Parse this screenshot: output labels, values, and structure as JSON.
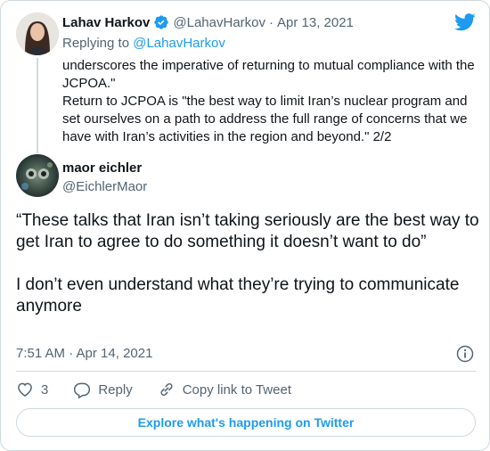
{
  "tweet1": {
    "author_name": "Lahav Harkov",
    "handle": "@LahavHarkov",
    "separator": "·",
    "date": "Apr 13, 2021",
    "replying_prefix": "Replying to ",
    "replying_handle": "@LahavHarkov",
    "paragraph1": "underscores the imperative of returning to mutual compliance with the JCPOA.\"",
    "paragraph2": "Return to JCPOA is \"the best way to limit Iran’s nuclear program and set ourselves on a path to address the full range of concerns that we have with Iran’s activities in the region and beyond.\" 2/2"
  },
  "tweet2": {
    "author_name": "maor eichler",
    "handle": "@EichlerMaor",
    "paragraph1": "“These talks that Iran isn’t taking seriously are the best way to get Iran to agree to do something it doesn’t want to do”",
    "paragraph2": "I don’t even understand what they’re trying to communicate anymore",
    "time": "7:51 AM · Apr 14, 2021"
  },
  "actions": {
    "like_count": "3",
    "reply_label": "Reply",
    "copy_link_label": "Copy link to Tweet"
  },
  "explore_label": "Explore what's happening on Twitter",
  "colors": {
    "accent": "#1d9bf0",
    "verified": "#1d9bf0",
    "muted_text": "#536471",
    "border": "#cfd9de"
  },
  "icons": [
    "twitter-bird-icon",
    "verified-badge-icon",
    "info-icon",
    "heart-icon",
    "reply-icon",
    "link-icon"
  ]
}
